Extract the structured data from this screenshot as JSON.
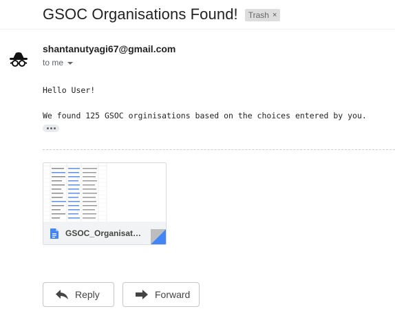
{
  "email": {
    "subject": "GSOC Organisations Found!",
    "label": "Trash",
    "sender": "shantanutyagi67@gmail.com",
    "recipient": "to me",
    "body_lines": [
      "Hello User!",
      "We found 125 GSOC orginisations based on the choices entered by you."
    ]
  },
  "attachment": {
    "name": "GSOC_Organisatio..."
  },
  "actions": {
    "reply": "Reply",
    "forward": "Forward"
  },
  "icons": {
    "avatar": "spy-avatar-icon",
    "label_remove": "close-icon",
    "recipient_dropdown": "caret-down-icon",
    "doc": "document-icon",
    "reply": "reply-icon",
    "forward": "forward-icon"
  },
  "colors": {
    "accent": "#4285f4",
    "label_bg": "#dddddd"
  }
}
